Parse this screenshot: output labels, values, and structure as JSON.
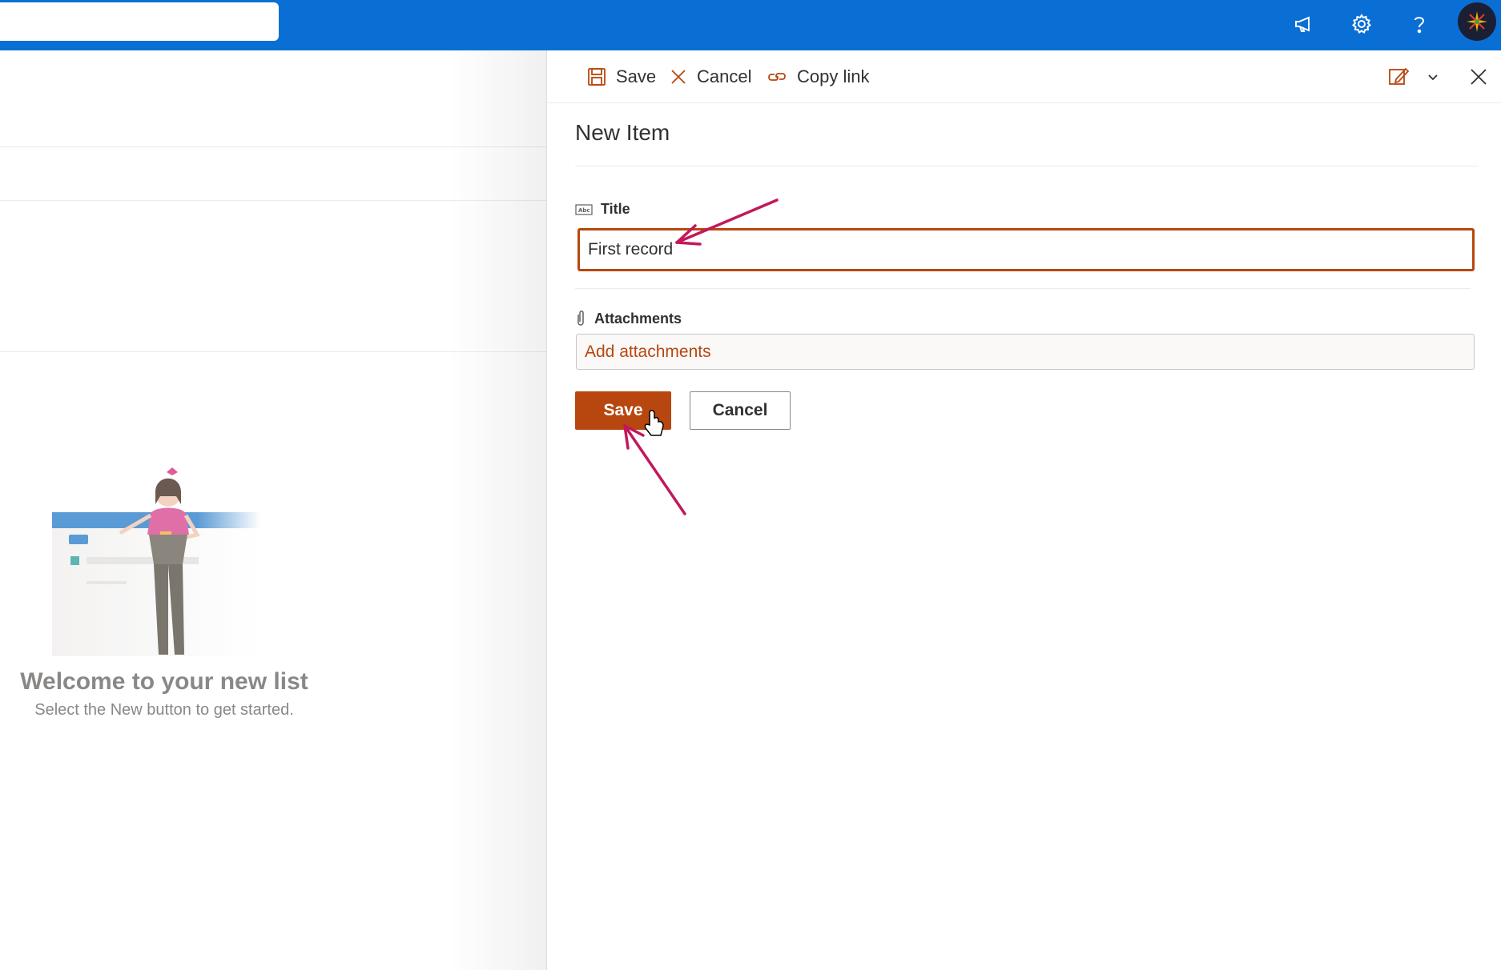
{
  "topbar": {
    "search_placeholder": "",
    "icons": [
      "megaphone-icon",
      "gear-icon",
      "help-icon",
      "avatar"
    ]
  },
  "background_page": {
    "welcome_title": "Welcome to your new list",
    "welcome_subtitle": "Select the New button to get started."
  },
  "panel": {
    "commands": {
      "save": "Save",
      "cancel": "Cancel",
      "copy_link": "Copy link"
    },
    "title": "New Item",
    "fields": {
      "title_label": "Title",
      "title_value": "First record",
      "attachments_label": "Attachments",
      "add_attachments": "Add attachments"
    },
    "buttons": {
      "save": "Save",
      "cancel": "Cancel"
    }
  },
  "colors": {
    "topbar": "#0a6fd4",
    "accent": "#b7470f",
    "annotation_arrow": "#c2185b"
  }
}
